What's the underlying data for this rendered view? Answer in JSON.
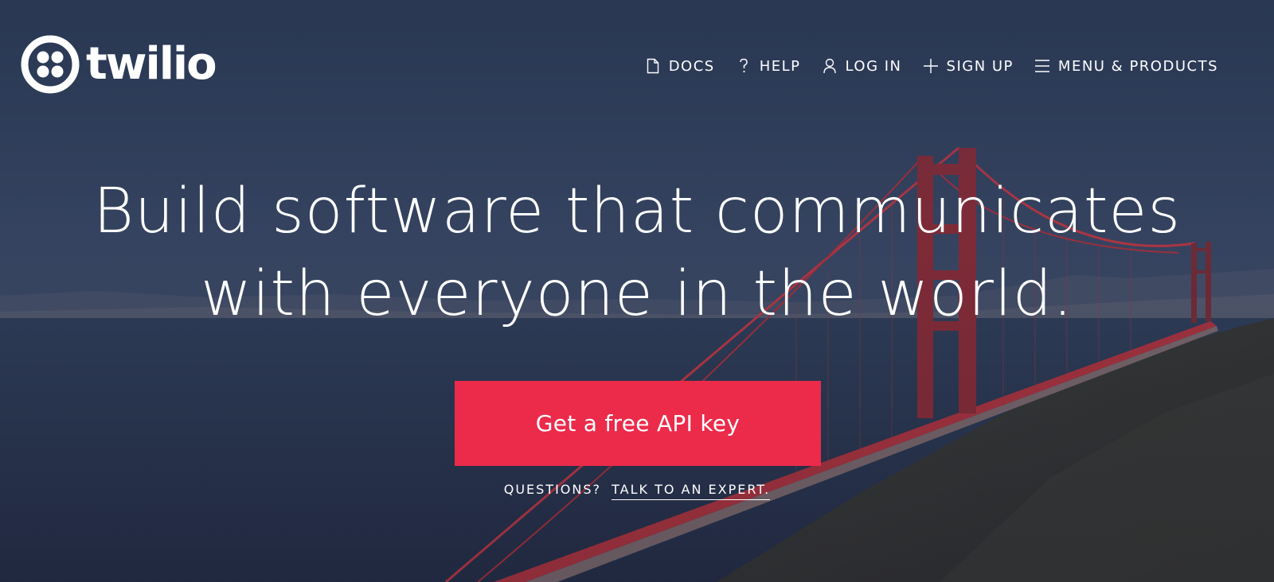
{
  "brand": {
    "name": "twilio"
  },
  "nav": {
    "items": [
      {
        "label": "DOCS",
        "icon": "document-icon"
      },
      {
        "label": "HELP",
        "icon": "question-icon"
      },
      {
        "label": "LOG IN",
        "icon": "user-icon"
      },
      {
        "label": "SIGN UP",
        "icon": "plus-icon"
      },
      {
        "label": "MENU & PRODUCTS",
        "icon": "hamburger-icon"
      }
    ]
  },
  "hero": {
    "headline_line1": "Build software that communicates",
    "headline_line2": "with everyone in the world.",
    "cta_label": "Get a free API key",
    "questions_prefix": "QUESTIONS?",
    "questions_link": "TALK TO AN EXPERT."
  },
  "colors": {
    "cta_background": "#ec2a4a",
    "text": "#ffffff",
    "sky": "#2f3e5b",
    "bridge": "#c7303c"
  }
}
